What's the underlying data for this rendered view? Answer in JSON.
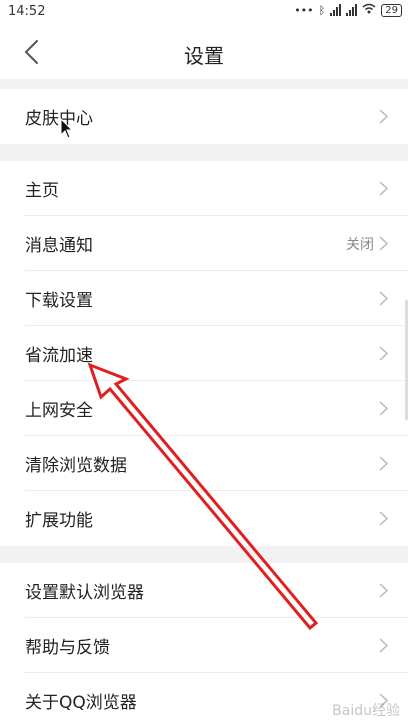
{
  "status_bar": {
    "time": "14:52",
    "battery": "29"
  },
  "header": {
    "title": "设置"
  },
  "groups": [
    {
      "items": [
        {
          "label": "皮肤中心",
          "value": ""
        }
      ]
    },
    {
      "items": [
        {
          "label": "主页",
          "value": ""
        },
        {
          "label": "消息通知",
          "value": "关闭"
        },
        {
          "label": "下载设置",
          "value": ""
        },
        {
          "label": "省流加速",
          "value": ""
        },
        {
          "label": "上网安全",
          "value": ""
        },
        {
          "label": "清除浏览数据",
          "value": ""
        },
        {
          "label": "扩展功能",
          "value": ""
        }
      ]
    },
    {
      "items": [
        {
          "label": "设置默认浏览器",
          "value": ""
        },
        {
          "label": "帮助与反馈",
          "value": ""
        },
        {
          "label": "关于QQ浏览器",
          "value": ""
        }
      ]
    }
  ],
  "watermark": "Baidu经验",
  "colors": {
    "annotation_arrow": "#e02020",
    "section_gap": "#f2f2f2",
    "divider": "#ececec",
    "value_text": "#888888"
  },
  "icons": {
    "back": "chevron-left-icon",
    "item_arrow": "chevron-right-icon"
  }
}
